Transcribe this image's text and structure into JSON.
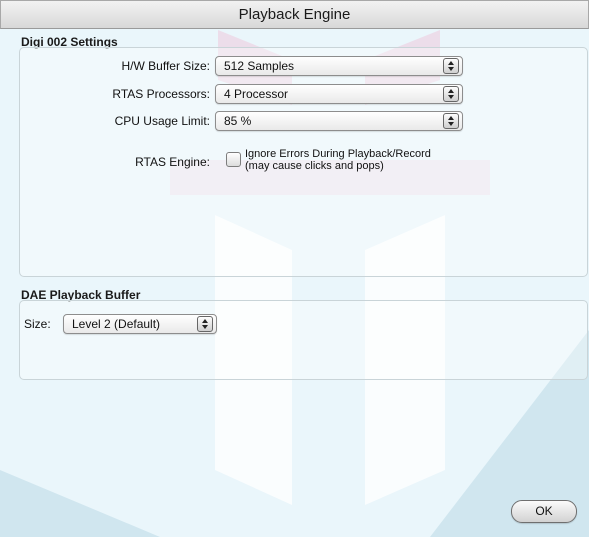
{
  "window": {
    "title": "Playback Engine"
  },
  "digi_settings": {
    "title": "Digi 002 Settings",
    "hw_buffer": {
      "label": "H/W Buffer Size:",
      "value": "512 Samples"
    },
    "rtas_processors": {
      "label": "RTAS Processors:",
      "value": "4 Processor"
    },
    "cpu_usage": {
      "label": "CPU Usage Limit:",
      "value": "85 %"
    },
    "rtas_engine": {
      "label": "RTAS Engine:",
      "option_line1": "Ignore Errors During Playback/Record",
      "option_line2": "(may cause clicks and pops)",
      "checked": false
    }
  },
  "dae_buffer": {
    "title": "DAE Playback Buffer",
    "size_label": "Size:",
    "size_value": "Level 2 (Default)"
  },
  "ok_label": "OK",
  "colors": {
    "window_bg": "#eaf6fb",
    "watermark": "#d4e6ee"
  }
}
